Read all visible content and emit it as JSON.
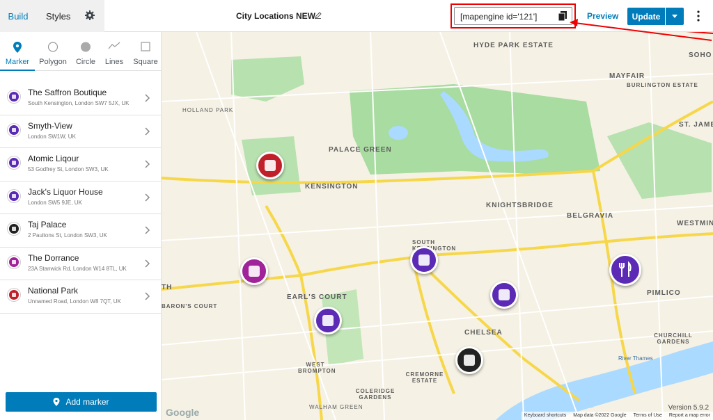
{
  "topbar": {
    "tab_build": "Build",
    "tab_styles": "Styles",
    "map_title": "City Locations NEW",
    "shortcode": "[mapengine id='121']",
    "preview": "Preview",
    "update": "Update"
  },
  "shape_tabs": [
    "Marker",
    "Polygon",
    "Circle",
    "Lines",
    "Square"
  ],
  "markers": [
    {
      "name": "The Saffron Boutique",
      "address": "South Kensington, London SW7 5JX, UK",
      "color": "#5b2bb5"
    },
    {
      "name": "Smyth-View",
      "address": "London SW1W, UK",
      "color": "#5b2bb5"
    },
    {
      "name": "Atomic Liqour",
      "address": "53 Godfrey St, London SW3, UK",
      "color": "#5b2bb5"
    },
    {
      "name": "Jack's Liquor House",
      "address": "London SW5 9JE, UK",
      "color": "#5b2bb5"
    },
    {
      "name": "Taj Palace",
      "address": "2 Paultons St, London SW3, UK",
      "color": "#222222"
    },
    {
      "name": "The Dorrance",
      "address": "23A Stanwick Rd, London W14 8TL, UK",
      "color": "#a0239a"
    },
    {
      "name": "National Park",
      "address": "Unnamed Road, London W8 7QT, UK",
      "color": "#c0202a"
    }
  ],
  "add_marker": "Add marker",
  "map": {
    "places": [
      "HYDE PARK ESTATE",
      "MAYFAIR",
      "BURLINGTON ESTATE",
      "SOHO",
      "HOLLAND PARK",
      "ST. JAMES",
      "PALACE GREEN",
      "KENSINGTON",
      "KNIGHTSBRIDGE",
      "BELGRAVIA",
      "WESTMIN",
      "SOUTH KENSINGTON",
      "PIMLICO",
      "EARL'S COURT",
      "BARON'S COURT",
      "CHELSEA",
      "CHURCHILL GARDENS",
      "WEST BROMPTON",
      "CREMORNE ESTATE",
      "COLERIDGE GARDENS",
      "WALHAM GREEN",
      "River Thames",
      "TH"
    ],
    "footer": [
      "Keyboard shortcuts",
      "Map data ©2022 Google",
      "Terms of Use",
      "Report a map error"
    ],
    "google": "Google",
    "version": "Version 5.9.2"
  }
}
